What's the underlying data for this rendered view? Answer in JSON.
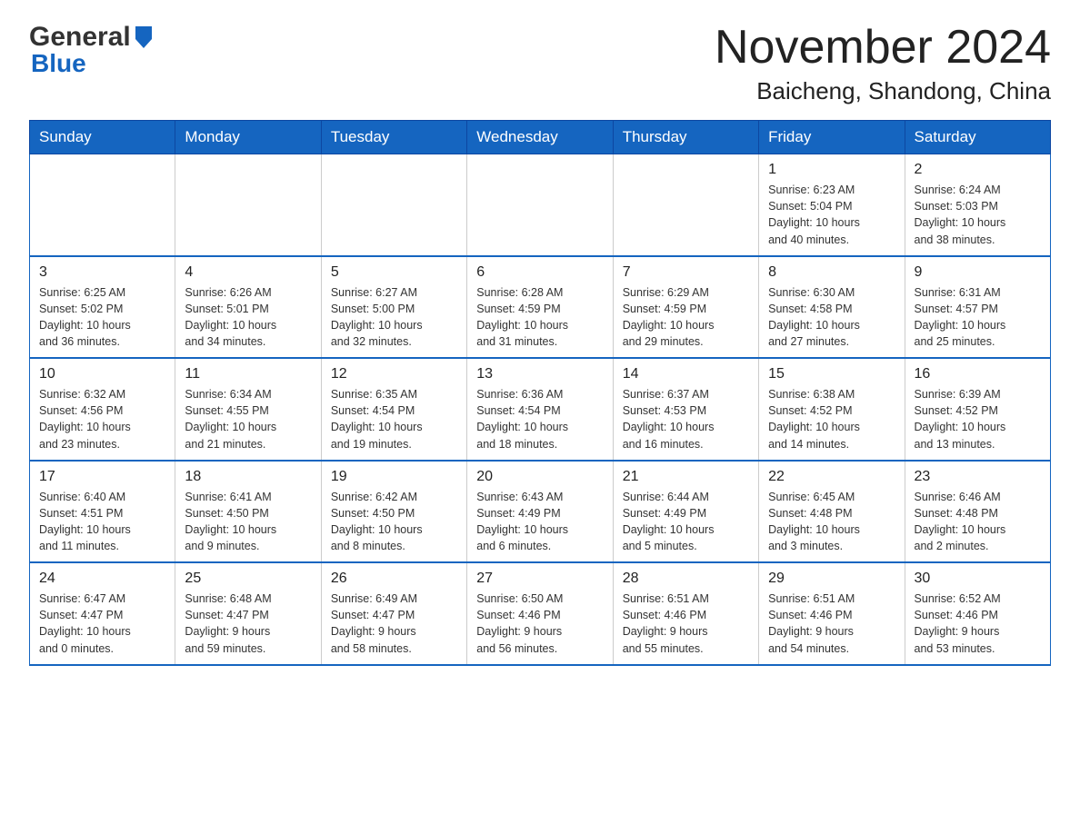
{
  "header": {
    "logo_general": "General",
    "logo_blue": "Blue",
    "title": "November 2024",
    "subtitle": "Baicheng, Shandong, China"
  },
  "days_of_week": [
    "Sunday",
    "Monday",
    "Tuesday",
    "Wednesday",
    "Thursday",
    "Friday",
    "Saturday"
  ],
  "weeks": [
    {
      "days": [
        {
          "number": "",
          "info": ""
        },
        {
          "number": "",
          "info": ""
        },
        {
          "number": "",
          "info": ""
        },
        {
          "number": "",
          "info": ""
        },
        {
          "number": "",
          "info": ""
        },
        {
          "number": "1",
          "info": "Sunrise: 6:23 AM\nSunset: 5:04 PM\nDaylight: 10 hours\nand 40 minutes."
        },
        {
          "number": "2",
          "info": "Sunrise: 6:24 AM\nSunset: 5:03 PM\nDaylight: 10 hours\nand 38 minutes."
        }
      ]
    },
    {
      "days": [
        {
          "number": "3",
          "info": "Sunrise: 6:25 AM\nSunset: 5:02 PM\nDaylight: 10 hours\nand 36 minutes."
        },
        {
          "number": "4",
          "info": "Sunrise: 6:26 AM\nSunset: 5:01 PM\nDaylight: 10 hours\nand 34 minutes."
        },
        {
          "number": "5",
          "info": "Sunrise: 6:27 AM\nSunset: 5:00 PM\nDaylight: 10 hours\nand 32 minutes."
        },
        {
          "number": "6",
          "info": "Sunrise: 6:28 AM\nSunset: 4:59 PM\nDaylight: 10 hours\nand 31 minutes."
        },
        {
          "number": "7",
          "info": "Sunrise: 6:29 AM\nSunset: 4:59 PM\nDaylight: 10 hours\nand 29 minutes."
        },
        {
          "number": "8",
          "info": "Sunrise: 6:30 AM\nSunset: 4:58 PM\nDaylight: 10 hours\nand 27 minutes."
        },
        {
          "number": "9",
          "info": "Sunrise: 6:31 AM\nSunset: 4:57 PM\nDaylight: 10 hours\nand 25 minutes."
        }
      ]
    },
    {
      "days": [
        {
          "number": "10",
          "info": "Sunrise: 6:32 AM\nSunset: 4:56 PM\nDaylight: 10 hours\nand 23 minutes."
        },
        {
          "number": "11",
          "info": "Sunrise: 6:34 AM\nSunset: 4:55 PM\nDaylight: 10 hours\nand 21 minutes."
        },
        {
          "number": "12",
          "info": "Sunrise: 6:35 AM\nSunset: 4:54 PM\nDaylight: 10 hours\nand 19 minutes."
        },
        {
          "number": "13",
          "info": "Sunrise: 6:36 AM\nSunset: 4:54 PM\nDaylight: 10 hours\nand 18 minutes."
        },
        {
          "number": "14",
          "info": "Sunrise: 6:37 AM\nSunset: 4:53 PM\nDaylight: 10 hours\nand 16 minutes."
        },
        {
          "number": "15",
          "info": "Sunrise: 6:38 AM\nSunset: 4:52 PM\nDaylight: 10 hours\nand 14 minutes."
        },
        {
          "number": "16",
          "info": "Sunrise: 6:39 AM\nSunset: 4:52 PM\nDaylight: 10 hours\nand 13 minutes."
        }
      ]
    },
    {
      "days": [
        {
          "number": "17",
          "info": "Sunrise: 6:40 AM\nSunset: 4:51 PM\nDaylight: 10 hours\nand 11 minutes."
        },
        {
          "number": "18",
          "info": "Sunrise: 6:41 AM\nSunset: 4:50 PM\nDaylight: 10 hours\nand 9 minutes."
        },
        {
          "number": "19",
          "info": "Sunrise: 6:42 AM\nSunset: 4:50 PM\nDaylight: 10 hours\nand 8 minutes."
        },
        {
          "number": "20",
          "info": "Sunrise: 6:43 AM\nSunset: 4:49 PM\nDaylight: 10 hours\nand 6 minutes."
        },
        {
          "number": "21",
          "info": "Sunrise: 6:44 AM\nSunset: 4:49 PM\nDaylight: 10 hours\nand 5 minutes."
        },
        {
          "number": "22",
          "info": "Sunrise: 6:45 AM\nSunset: 4:48 PM\nDaylight: 10 hours\nand 3 minutes."
        },
        {
          "number": "23",
          "info": "Sunrise: 6:46 AM\nSunset: 4:48 PM\nDaylight: 10 hours\nand 2 minutes."
        }
      ]
    },
    {
      "days": [
        {
          "number": "24",
          "info": "Sunrise: 6:47 AM\nSunset: 4:47 PM\nDaylight: 10 hours\nand 0 minutes."
        },
        {
          "number": "25",
          "info": "Sunrise: 6:48 AM\nSunset: 4:47 PM\nDaylight: 9 hours\nand 59 minutes."
        },
        {
          "number": "26",
          "info": "Sunrise: 6:49 AM\nSunset: 4:47 PM\nDaylight: 9 hours\nand 58 minutes."
        },
        {
          "number": "27",
          "info": "Sunrise: 6:50 AM\nSunset: 4:46 PM\nDaylight: 9 hours\nand 56 minutes."
        },
        {
          "number": "28",
          "info": "Sunrise: 6:51 AM\nSunset: 4:46 PM\nDaylight: 9 hours\nand 55 minutes."
        },
        {
          "number": "29",
          "info": "Sunrise: 6:51 AM\nSunset: 4:46 PM\nDaylight: 9 hours\nand 54 minutes."
        },
        {
          "number": "30",
          "info": "Sunrise: 6:52 AM\nSunset: 4:46 PM\nDaylight: 9 hours\nand 53 minutes."
        }
      ]
    }
  ]
}
